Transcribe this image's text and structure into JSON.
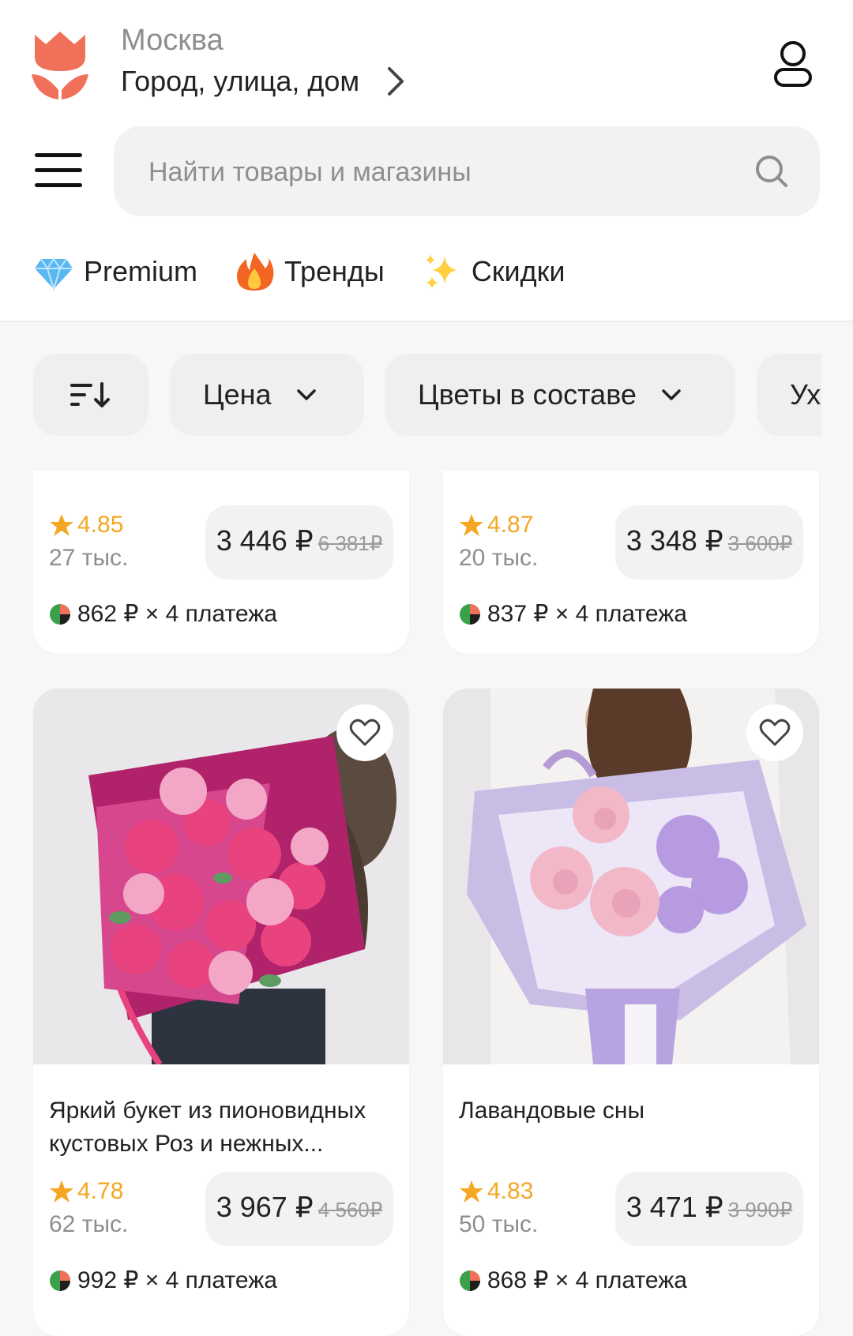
{
  "header": {
    "city": "Москва",
    "address": "Город, улица, дом"
  },
  "search": {
    "placeholder": "Найти товары и магазины"
  },
  "quick_links": [
    {
      "label": "Premium",
      "icon": "diamond-icon"
    },
    {
      "label": "Тренды",
      "icon": "fire-icon"
    },
    {
      "label": "Скидки",
      "icon": "sparkles-icon"
    }
  ],
  "filters": [
    {
      "label": "",
      "icon": "sort-icon"
    },
    {
      "label": "Цена",
      "icon": "chevron-down-icon"
    },
    {
      "label": "Цветы в составе",
      "icon": "chevron-down-icon"
    },
    {
      "label": "Ух",
      "icon": ""
    }
  ],
  "colors": {
    "accent": "#f0705a",
    "star": "#f5a623",
    "pill_bg": "#f2f2f2"
  },
  "products": [
    {
      "title": "",
      "rating": "4.85",
      "reviews": "27 тыс.",
      "price": "3 446 ₽",
      "old_price": "6 381₽",
      "installment": "862 ₽ × 4 платежа"
    },
    {
      "title": "",
      "rating": "4.87",
      "reviews": "20 тыс.",
      "price": "3 348 ₽",
      "old_price": "3 600₽",
      "installment": "837 ₽ × 4 платежа"
    },
    {
      "title": "Яркий букет из пионовидных кустовых Роз и нежных...",
      "rating": "4.78",
      "reviews": "62 тыс.",
      "price": "3 967 ₽",
      "old_price": "4 560₽",
      "installment": "992 ₽ × 4 платежа"
    },
    {
      "title": "Лавандовые сны",
      "rating": "4.83",
      "reviews": "50 тыс.",
      "price": "3 471 ₽",
      "old_price": "3 990₽",
      "installment": "868 ₽ × 4 платежа"
    }
  ]
}
